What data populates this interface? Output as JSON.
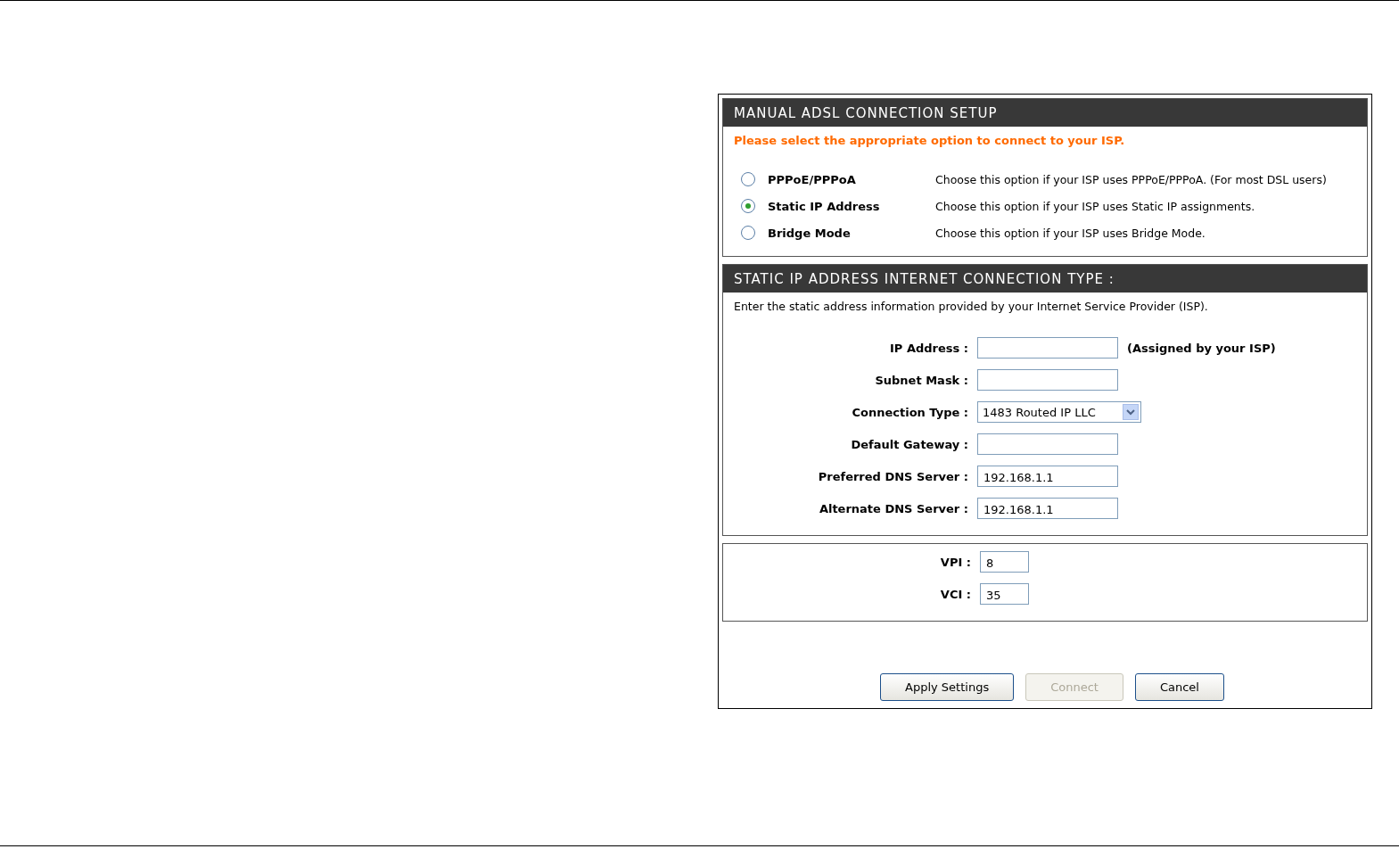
{
  "setup": {
    "title": "MANUAL ADSL CONNECTION SETUP",
    "prompt": "Please select the appropriate option to connect to your ISP.",
    "options": [
      {
        "label": "PPPoE/PPPoA",
        "description": "Choose this option if your ISP uses PPPoE/PPPoA. (For most DSL users)",
        "selected": false
      },
      {
        "label": "Static IP Address",
        "description": "Choose this option if your ISP uses Static IP assignments.",
        "selected": true
      },
      {
        "label": "Bridge Mode",
        "description": "Choose this option if your ISP uses Bridge Mode.",
        "selected": false
      }
    ]
  },
  "static_ip": {
    "title": "STATIC IP ADDRESS INTERNET CONNECTION TYPE :",
    "description": "Enter the static address information provided by your Internet Service Provider (ISP).",
    "fields": [
      {
        "kind": "text",
        "label": "IP Address :",
        "note": "(Assigned by your ISP)"
      },
      {
        "kind": "text",
        "label": "Subnet Mask :"
      },
      {
        "kind": "select",
        "label": "Connection Type :",
        "value": "1483 Routed IP LLC"
      },
      {
        "kind": "text",
        "label": "Default Gateway :"
      },
      {
        "kind": "text",
        "label": "Preferred DNS Server :",
        "value": "192.168.1.1"
      },
      {
        "kind": "text",
        "label": "Alternate DNS Server :",
        "value": "192.168.1.1"
      }
    ]
  },
  "atm": {
    "fields": [
      {
        "label": "VPI :",
        "value": "8"
      },
      {
        "label": "VCI :",
        "value": "35"
      }
    ]
  },
  "buttons": [
    {
      "label": "Apply Settings",
      "disabled": false
    },
    {
      "label": "Connect",
      "disabled": true
    },
    {
      "label": "Cancel",
      "disabled": false
    }
  ]
}
